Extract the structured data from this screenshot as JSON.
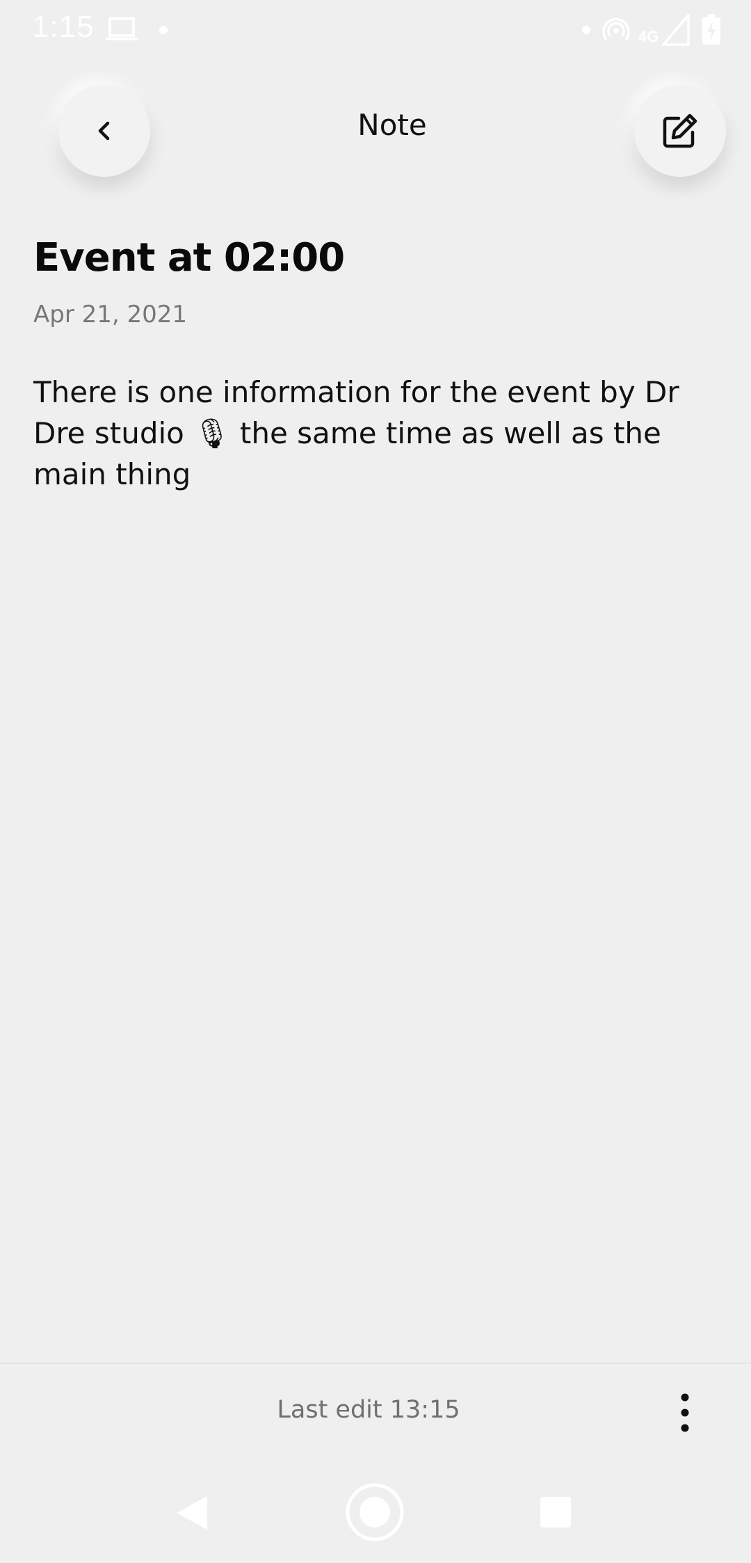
{
  "status_bar": {
    "time": "1:15",
    "network": "4G"
  },
  "header": {
    "title": "Note"
  },
  "note": {
    "title": "Event at 02:00",
    "date": "Apr 21, 2021",
    "body": "There is one information for the event by Dr Dre studio 🎙 the same time as well as the main thing"
  },
  "footer": {
    "last_edit": "Last edit 13:15"
  },
  "icons": {
    "back": "chevron-left-icon",
    "edit": "edit-square-pencil-icon",
    "more": "more-vertical-icon"
  },
  "colors": {
    "background": "#efefef",
    "text": "#111111",
    "muted": "#777777"
  }
}
